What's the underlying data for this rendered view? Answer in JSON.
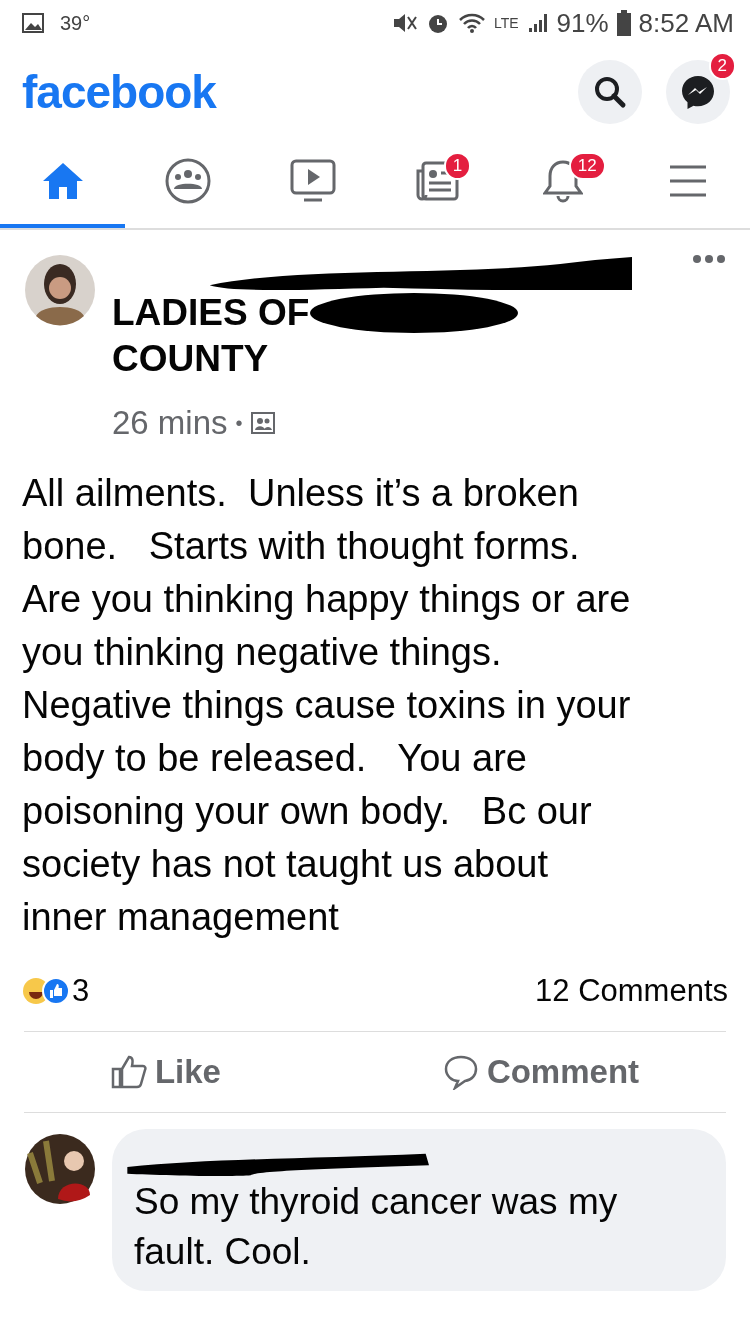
{
  "status_bar": {
    "temperature": "39°",
    "network": "LTE",
    "battery": "91%",
    "time": "8:52 AM"
  },
  "header": {
    "logo": "facebook",
    "messenger_badge": "2"
  },
  "tabs": [
    {
      "kind": "home",
      "selected": true
    },
    {
      "kind": "groups",
      "selected": false
    },
    {
      "kind": "watch",
      "selected": false
    },
    {
      "kind": "news",
      "selected": false,
      "badge": "1"
    },
    {
      "kind": "notifications",
      "selected": false,
      "badge": "12"
    },
    {
      "kind": "menu",
      "selected": false
    }
  ],
  "post": {
    "title_lines": [
      "LADIES OF",
      "COUNTY"
    ],
    "time": "26 mins",
    "separator": "•",
    "body": "All ailments.  Unless it’s a broken\nbone.   Starts with thought forms.\nAre you thinking happy things or are\nyou thinking negative things.\nNegative things cause toxins in your\nbody to be released.   You are\npoisoning your own body.   Bc our\nsociety has not taught us about\ninner management",
    "reaction_count": "3",
    "comments_count": "12 Comments",
    "actions": [
      "Like",
      "Comment"
    ]
  },
  "comment": {
    "text": "So my thyroid cancer was my\nfault. Cool."
  }
}
